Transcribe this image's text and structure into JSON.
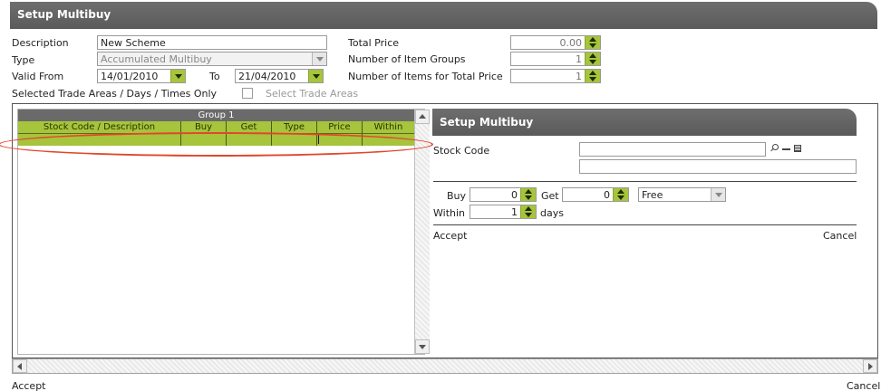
{
  "window": {
    "title": "Setup Multibuy"
  },
  "form": {
    "description_label": "Description",
    "description_value": "New Scheme",
    "type_label": "Type",
    "type_value": "Accumulated Multibuy",
    "valid_from_label": "Valid From",
    "valid_from_value": "14/01/2010",
    "to_label": "To",
    "to_value": "21/04/2010",
    "selected_areas_label": "Selected Trade Areas / Days / Times Only",
    "select_trade_areas_label": "Select Trade Areas",
    "total_price_label": "Total Price",
    "total_price_value": "0.00",
    "num_item_groups_label": "Number of Item Groups",
    "num_item_groups_value": "1",
    "num_items_total_label": "Number of Items for Total Price",
    "num_items_total_value": "1"
  },
  "grid": {
    "group_header": "Group 1",
    "columns": [
      "Stock Code / Description",
      "Buy",
      "Get",
      "Type",
      "Price",
      "Within"
    ]
  },
  "sub_panel": {
    "title": "Setup Multibuy",
    "stock_code_label": "Stock Code",
    "stock_code_value": "",
    "stock_desc_value": "",
    "buy_label": "Buy",
    "buy_value": "0",
    "get_label": "Get",
    "get_value": "0",
    "type_value": "Free",
    "within_label": "Within",
    "within_value": "1",
    "days_label": "days",
    "accept_label": "Accept",
    "cancel_label": "Cancel"
  },
  "footer": {
    "accept_label": "Accept",
    "cancel_label": "Cancel"
  },
  "colors": {
    "accent_green": "#a6c43c",
    "title_grey": "#5f5f5f",
    "highlight_red": "#e2462a"
  }
}
